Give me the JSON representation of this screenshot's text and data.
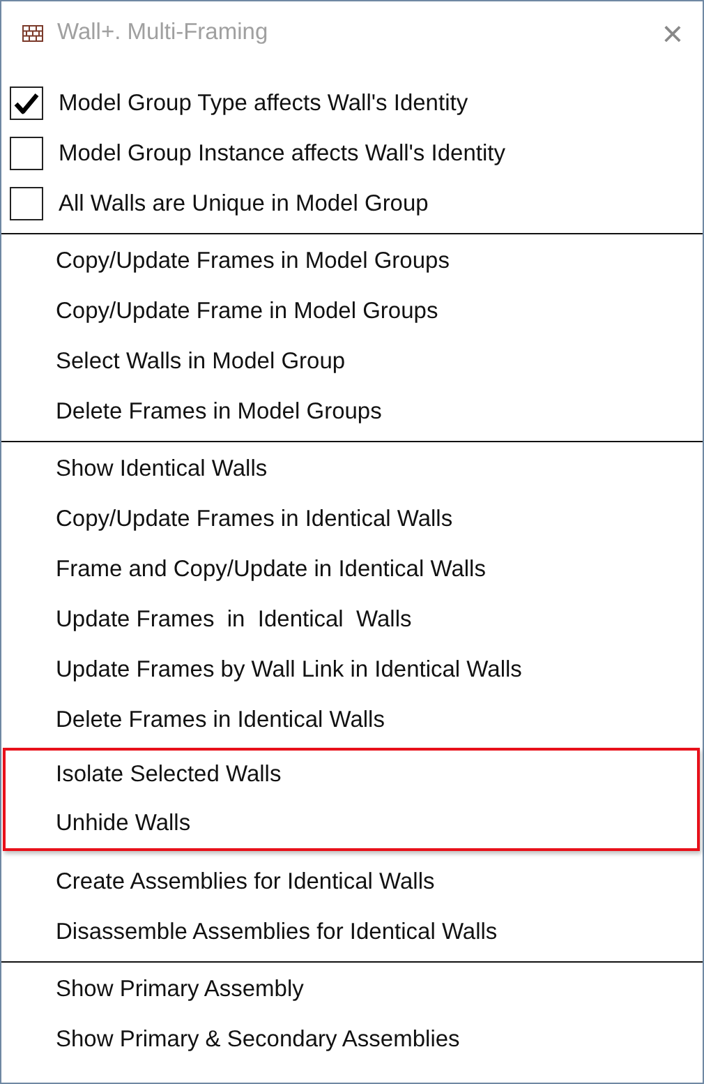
{
  "window": {
    "title": "Wall+. Multi-Framing",
    "close": "×"
  },
  "sections": [
    {
      "items": [
        {
          "kind": "checkbox",
          "label": "Model Group Type affects Wall's Identity",
          "checked": true
        },
        {
          "kind": "checkbox",
          "label": "Model Group Instance affects Wall's Identity",
          "checked": false
        },
        {
          "kind": "checkbox",
          "label": "All Walls are Unique in Model Group",
          "checked": false
        }
      ]
    },
    {
      "items": [
        {
          "kind": "command",
          "label": "Copy/Update Frames in Model Groups",
          "highlighted": false
        },
        {
          "kind": "command",
          "label": "Copy/Update Frame in Model Groups",
          "highlighted": false
        },
        {
          "kind": "command",
          "label": "Select Walls in Model Group",
          "highlighted": false
        },
        {
          "kind": "command",
          "label": "Delete Frames in Model Groups",
          "highlighted": false
        }
      ]
    },
    {
      "items": [
        {
          "kind": "command",
          "label": "Show Identical Walls",
          "highlighted": false
        },
        {
          "kind": "command",
          "label": "Copy/Update Frames in Identical Walls",
          "highlighted": false
        },
        {
          "kind": "command",
          "label": "Frame and Copy/Update in Identical Walls",
          "highlighted": false
        },
        {
          "kind": "command",
          "label": "Update Frames  in  Identical  Walls",
          "highlighted": false
        },
        {
          "kind": "command",
          "label": "Update Frames by Wall Link in Identical Walls",
          "highlighted": false
        },
        {
          "kind": "command",
          "label": "Delete Frames in Identical Walls",
          "highlighted": false
        },
        {
          "kind": "command",
          "label": "Isolate Selected Walls",
          "highlighted": true
        },
        {
          "kind": "command",
          "label": "Unhide Walls",
          "highlighted": true
        },
        {
          "kind": "command",
          "label": "Create Assemblies for Identical Walls",
          "highlighted": false
        },
        {
          "kind": "command",
          "label": "Disassemble Assemblies for Identical Walls",
          "highlighted": false
        }
      ]
    },
    {
      "items": [
        {
          "kind": "command",
          "label": "Show Primary Assembly",
          "highlighted": false
        },
        {
          "kind": "command",
          "label": "Show Primary & Secondary Assemblies",
          "highlighted": false
        }
      ]
    }
  ]
}
